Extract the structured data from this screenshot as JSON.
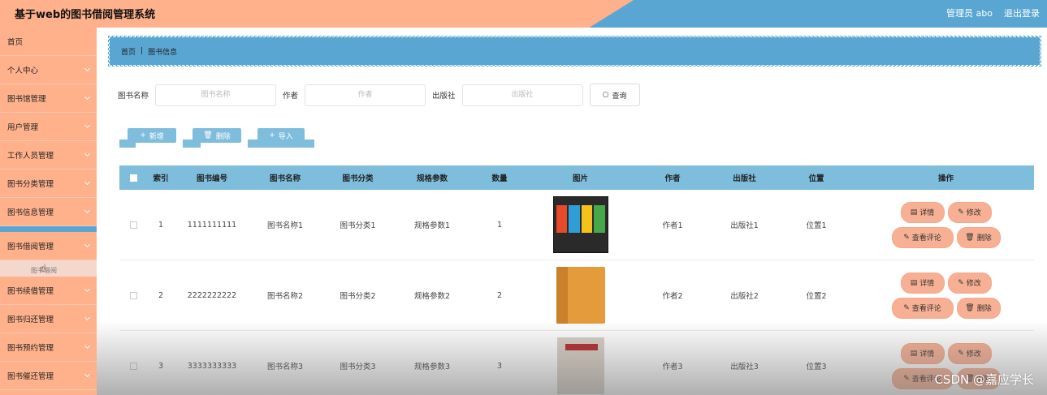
{
  "header": {
    "title": "基于web的图书借阅管理系统",
    "admin_label": "管理员 abo",
    "logout_label": "退出登录"
  },
  "sidebar": {
    "items": [
      {
        "label": "首页"
      },
      {
        "label": "个人中心"
      },
      {
        "label": "图书馆管理"
      },
      {
        "label": "用户管理"
      },
      {
        "label": "工作人员管理"
      },
      {
        "label": "图书分类管理"
      },
      {
        "label": "图书信息管理"
      },
      {
        "label": "图书借阅管理"
      },
      {
        "label": "图书续借管理"
      },
      {
        "label": "图书归还管理"
      },
      {
        "label": "图书预约管理"
      },
      {
        "label": "图书催还管理"
      }
    ],
    "sub_item": "图书借阅"
  },
  "breadcrumb": {
    "home": "首页",
    "sep": "|",
    "current": "图书信息"
  },
  "search": {
    "name_label": "图书名称",
    "name_placeholder": "图书名称",
    "author_label": "作者",
    "author_placeholder": "作者",
    "publisher_label": "出版社",
    "publisher_placeholder": "出版社",
    "search_button": "查询"
  },
  "actions": {
    "add": "新增",
    "delete": "删除",
    "import": "导入"
  },
  "table": {
    "headers": [
      "索引",
      "图书编号",
      "图书名称",
      "图书分类",
      "规格参数",
      "数量",
      "图片",
      "作者",
      "出版社",
      "位置",
      "操作"
    ],
    "rows": [
      {
        "index": "1",
        "code": "1111111111",
        "name": "图书名称1",
        "category": "图书分类1",
        "spec": "规格参数1",
        "qty": "1",
        "author": "作者1",
        "publisher": "出版社1",
        "location": "位置1"
      },
      {
        "index": "2",
        "code": "2222222222",
        "name": "图书名称2",
        "category": "图书分类2",
        "spec": "规格参数2",
        "qty": "2",
        "author": "作者2",
        "publisher": "出版社2",
        "location": "位置2"
      },
      {
        "index": "3",
        "code": "3333333333",
        "name": "图书名称3",
        "category": "图书分类3",
        "spec": "规格参数3",
        "qty": "3",
        "author": "作者3",
        "publisher": "出版社3",
        "location": "位置3"
      }
    ],
    "ops": {
      "detail": "详情",
      "edit": "修改",
      "review": "查看评论",
      "delete": "删除"
    }
  },
  "watermark": "CSDN @嘉应学长",
  "colors": {
    "header_blue": "#5aa6d2",
    "peach": "#ffb18c",
    "table_head": "#7fbddc",
    "op_button": "#f7b093"
  }
}
